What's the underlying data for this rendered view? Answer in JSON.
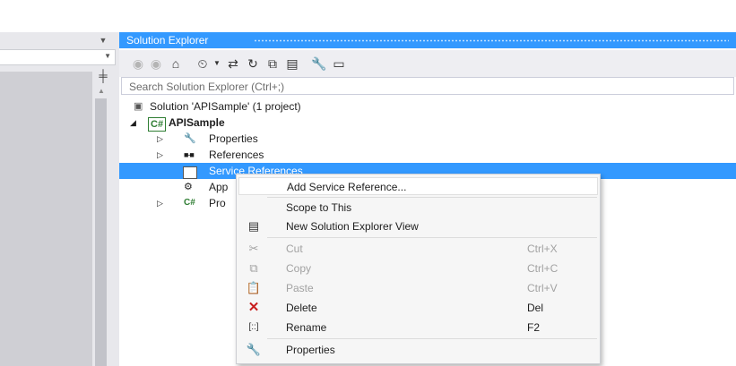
{
  "window": {
    "panel_title": "Solution Explorer"
  },
  "search": {
    "placeholder": "Search Solution Explorer (Ctrl+;)"
  },
  "toolbar": {
    "icons": [
      "back-icon",
      "forward-icon",
      "home-icon",
      "pending-changes-icon",
      "dropdown-icon",
      "sync-icon",
      "refresh-icon",
      "collapse-all-icon",
      "show-all-files-icon",
      "properties-icon",
      "preview-icon"
    ]
  },
  "tree": {
    "solution": "Solution 'APISample' (1 project)",
    "project_badge": "C#",
    "project": "APISample",
    "properties": "Properties",
    "references": "References",
    "service_references": "Service References",
    "app_config": "App",
    "program_badge": "C#",
    "program": "Pro"
  },
  "context_menu": {
    "items": [
      {
        "label": "Add Service Reference...",
        "shortcut": "",
        "icon": ""
      },
      {
        "label": "Scope to This",
        "shortcut": "",
        "icon": ""
      },
      {
        "label": "New Solution Explorer View",
        "shortcut": "",
        "icon": "new-view-icon"
      },
      {
        "label": "Cut",
        "shortcut": "Ctrl+X",
        "icon": "scissors-icon",
        "disabled": true
      },
      {
        "label": "Copy",
        "shortcut": "Ctrl+C",
        "icon": "copy-icon",
        "disabled": true
      },
      {
        "label": "Paste",
        "shortcut": "Ctrl+V",
        "icon": "paste-icon",
        "disabled": true
      },
      {
        "label": "Delete",
        "shortcut": "Del",
        "icon": "delete-x-icon"
      },
      {
        "label": "Rename",
        "shortcut": "F2",
        "icon": "rename-icon"
      },
      {
        "label": "Properties",
        "shortcut": "",
        "icon": "wrench-icon"
      }
    ]
  },
  "colors": {
    "accent": "#3399ff",
    "delete_red": "#c81e1e",
    "csharp_green": "#2e7d32"
  }
}
